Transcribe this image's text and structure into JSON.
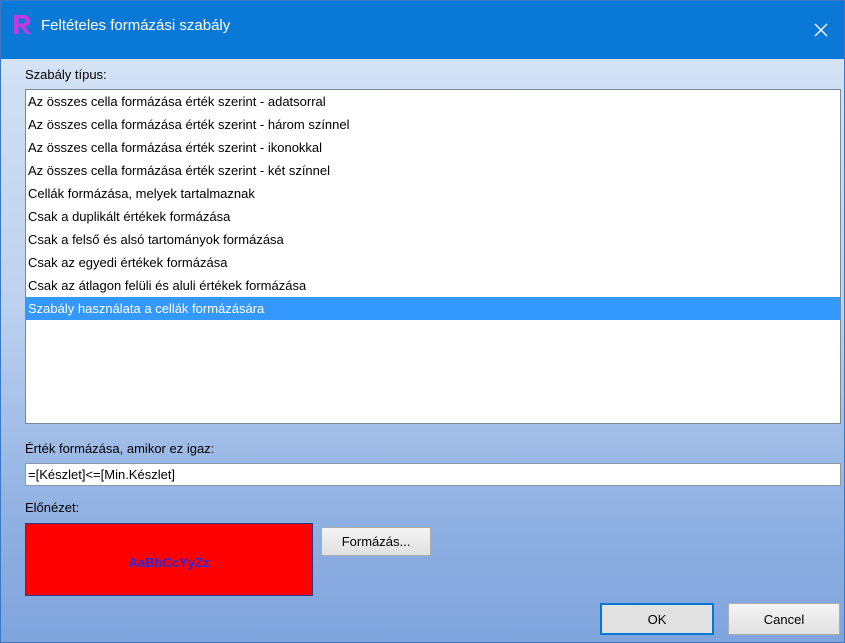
{
  "window": {
    "title": "Feltételes formázási szabály"
  },
  "rule_type": {
    "label": "Szabály típus:",
    "items": [
      "Az összes cella formázása érték szerint - adatsorral",
      "Az összes cella formázása érték szerint - három színnel",
      "Az összes cella formázása érték szerint - ikonokkal",
      "Az összes cella formázása érték szerint - két színnel",
      "Cellák formázása, melyek tartalmaznak",
      "Csak a duplikált értékek formázása",
      "Csak a felső és alsó tartományok formázása",
      "Csak az egyedi értékek formázása",
      "Csak az átlagon felüli és aluli értékek formázása",
      "Szabály használata a cellák formázására"
    ],
    "selected_index": 9
  },
  "condition": {
    "label": "Érték formázása, amikor ez igaz:",
    "value": "=[Készlet]<=[Min.Készlet]"
  },
  "preview": {
    "label": "Előnézet:",
    "sample_text": "AaBbCcYyZz",
    "background_color": "#ff0000",
    "text_color": "#2b2bd6"
  },
  "buttons": {
    "format": "Formázás...",
    "ok": "OK",
    "cancel": "Cancel"
  },
  "colors": {
    "titlebar": "#0a78d7",
    "selection": "#3399ff"
  }
}
